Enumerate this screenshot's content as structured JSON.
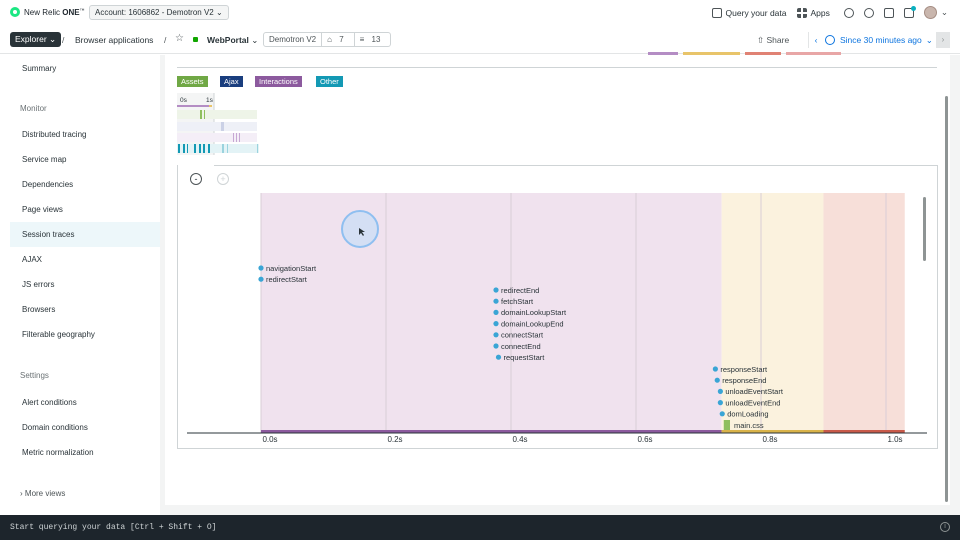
{
  "app": {
    "logo_text": "New Relic",
    "logo_bold": "ONE",
    "logo_tm": "™"
  },
  "account": {
    "label": "Account: 1606862 - Demotron V2",
    "chevron": "⌄"
  },
  "top_right": {
    "query": "Query your data",
    "apps": "Apps"
  },
  "navbar": {
    "explorer": "Explorer",
    "explorer_chevron": "⌄",
    "sep1": "/",
    "crumb1": "Browser applications",
    "sep2": "/",
    "star": "☆",
    "entity": "WebPortal",
    "entity_chevron": "⌄",
    "account_tag": "Demotron V2",
    "tags_count": "7",
    "related_count": "13",
    "share": "Share",
    "time_prev": "‹",
    "time_label": "Since 30 minutes ago",
    "time_chevron": "⌄",
    "time_next": "›"
  },
  "sidebar": {
    "summary": "Summary",
    "monitor_heading": "Monitor",
    "monitor_items": [
      "Distributed tracing",
      "Service map",
      "Dependencies",
      "Page views",
      "Session traces",
      "AJAX",
      "JS errors",
      "Browsers",
      "Filterable geography"
    ],
    "active_item": "Session traces",
    "settings_heading": "Settings",
    "settings_items": [
      "Alert conditions",
      "Domain conditions",
      "Metric normalization"
    ],
    "more_views": "More views",
    "more_chevron": "›"
  },
  "legend": [
    {
      "label": "Assets",
      "color": "#70a845"
    },
    {
      "label": "Ajax",
      "color": "#1a3e7e"
    },
    {
      "label": "Interactions",
      "color": "#8c5a9e"
    },
    {
      "label": "Other",
      "color": "#1399b4"
    }
  ],
  "minimap": {
    "tick0": "0s",
    "tick1": "1s"
  },
  "zoom": {
    "out": "-",
    "in": "+"
  },
  "chart_data": {
    "type": "timeline",
    "x_ticks": [
      "0.0s",
      "0.2s",
      "0.4s",
      "0.6s",
      "0.8s",
      "1.0s"
    ],
    "xlim": [
      -0.0,
      1.02
    ],
    "phases": [
      {
        "start": 0.0,
        "end": 0.737,
        "color": "#f0e2ee"
      },
      {
        "start": 0.737,
        "end": 0.9,
        "color": "#fbf2de"
      },
      {
        "start": 0.9,
        "end": 1.03,
        "color": "#f7dfd9"
      }
    ],
    "events": [
      {
        "name": "navigationStart",
        "t": 0.0
      },
      {
        "name": "redirectStart",
        "t": 0.0
      },
      {
        "name": "redirectEnd",
        "t": 0.376
      },
      {
        "name": "fetchStart",
        "t": 0.376
      },
      {
        "name": "domainLookupStart",
        "t": 0.376
      },
      {
        "name": "domainLookupEnd",
        "t": 0.376
      },
      {
        "name": "connectStart",
        "t": 0.376
      },
      {
        "name": "connectEnd",
        "t": 0.376
      },
      {
        "name": "requestStart",
        "t": 0.38
      },
      {
        "name": "responseStart",
        "t": 0.727
      },
      {
        "name": "responseEnd",
        "t": 0.73
      },
      {
        "name": "unloadEventStart",
        "t": 0.735
      },
      {
        "name": "unloadEventEnd",
        "t": 0.735
      },
      {
        "name": "domLoading",
        "t": 0.738
      }
    ],
    "assets": [
      {
        "name": "main.css",
        "start": 0.742,
        "end": 0.752
      }
    ],
    "colors": {
      "event_dot": "#3aa5d5",
      "asset": "#8fbf5e"
    }
  },
  "query_bar": {
    "text": "Start querying your data [Ctrl + Shift + O]",
    "info": "i"
  }
}
